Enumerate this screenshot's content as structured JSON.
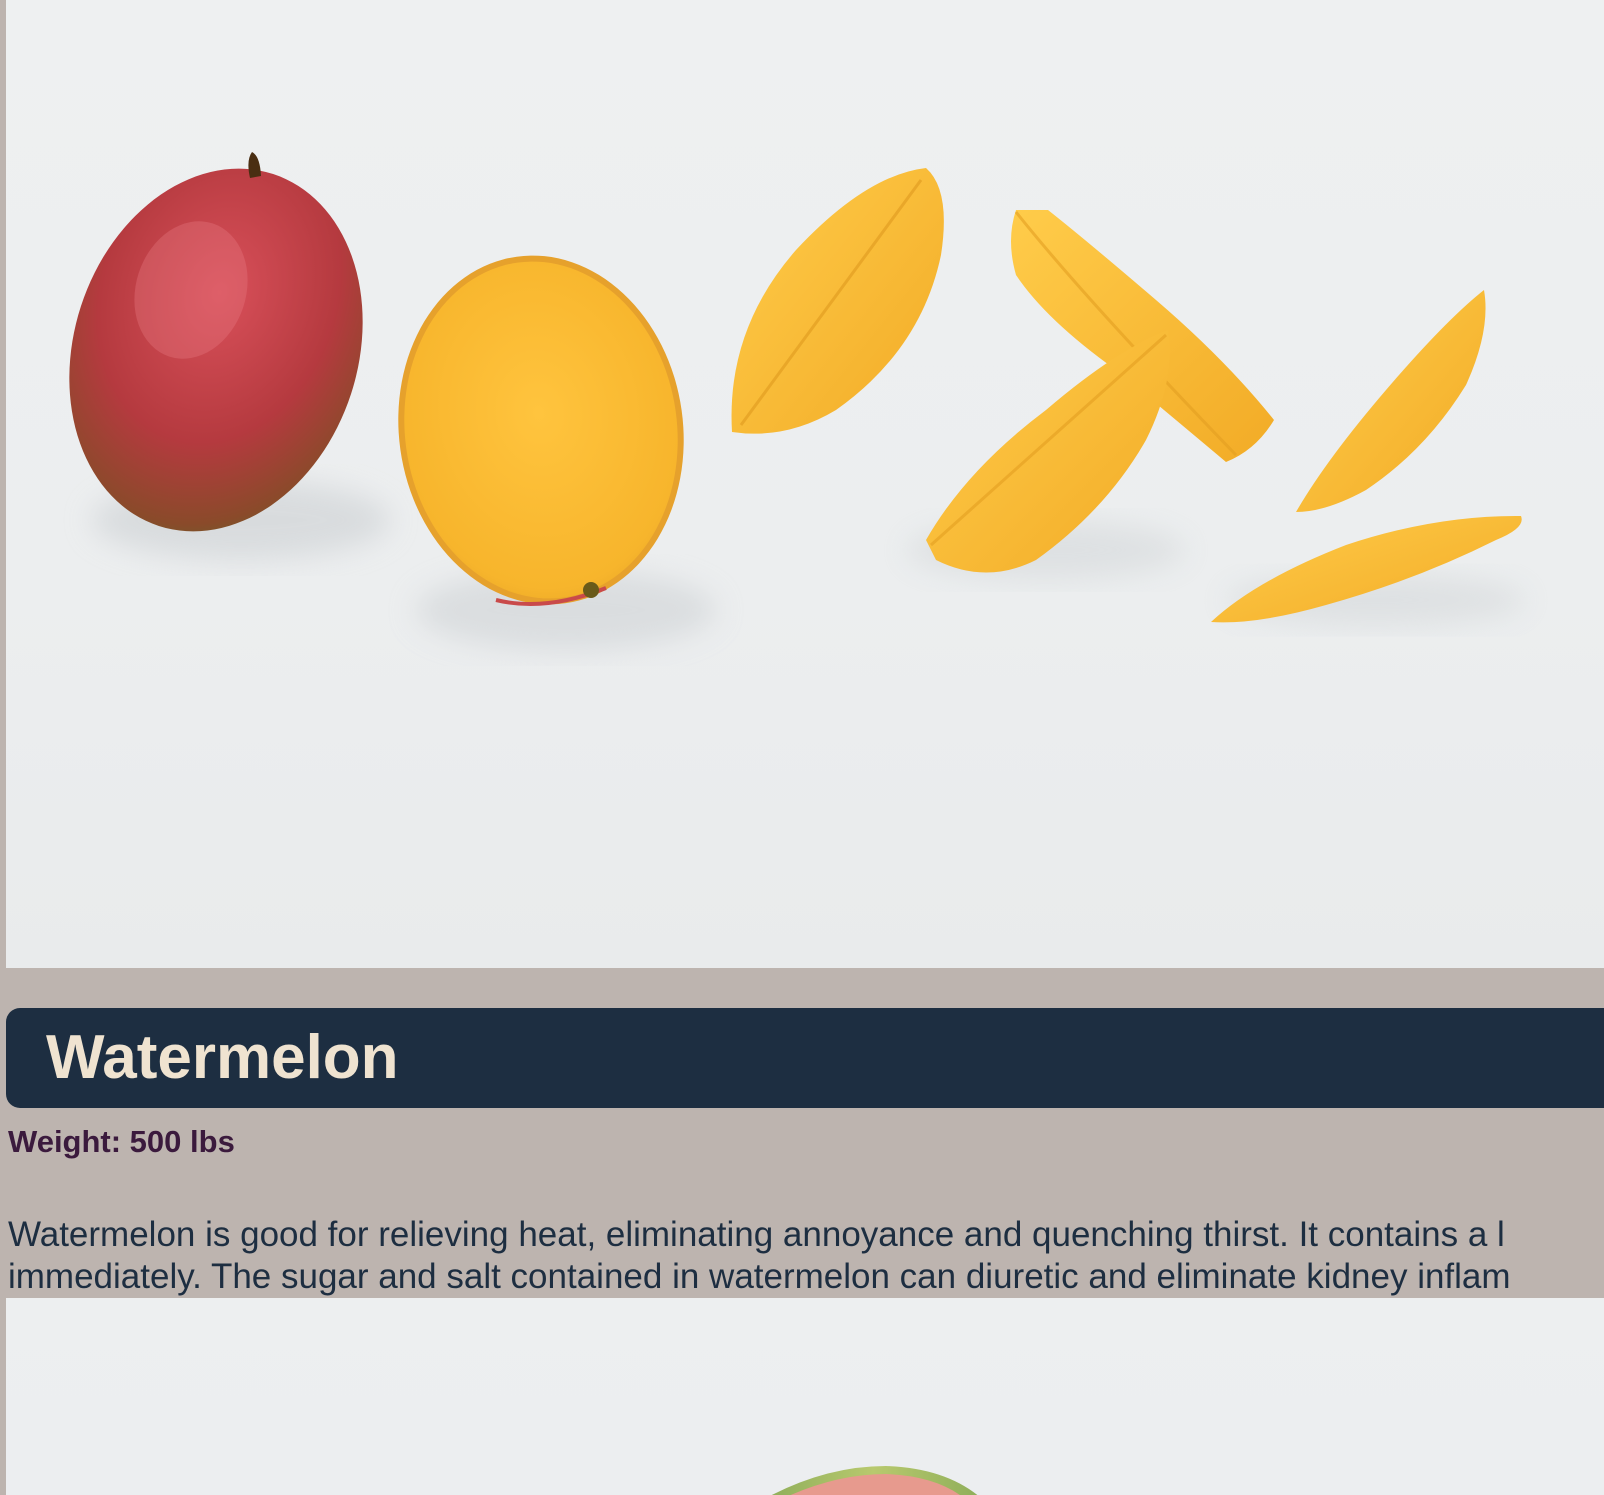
{
  "product": {
    "title": "Watermelon",
    "weight": "Weight: 500 lbs",
    "description_lines": [
      "Watermelon is good for relieving heat, eliminating annoyance and quenching thirst. It contains a l",
      "immediately. The sugar and salt contained in watermelon can diuretic and eliminate kidney inflam"
    ]
  },
  "images": {
    "top": "mango-photo",
    "bottom": "watermelon-photo"
  },
  "colors": {
    "page_background": "#bdb4af",
    "title_bar": "#1d2e41",
    "title_text": "#efe3d0",
    "weight_text": "#3b1a3d",
    "description_text": "#1d2e41"
  }
}
